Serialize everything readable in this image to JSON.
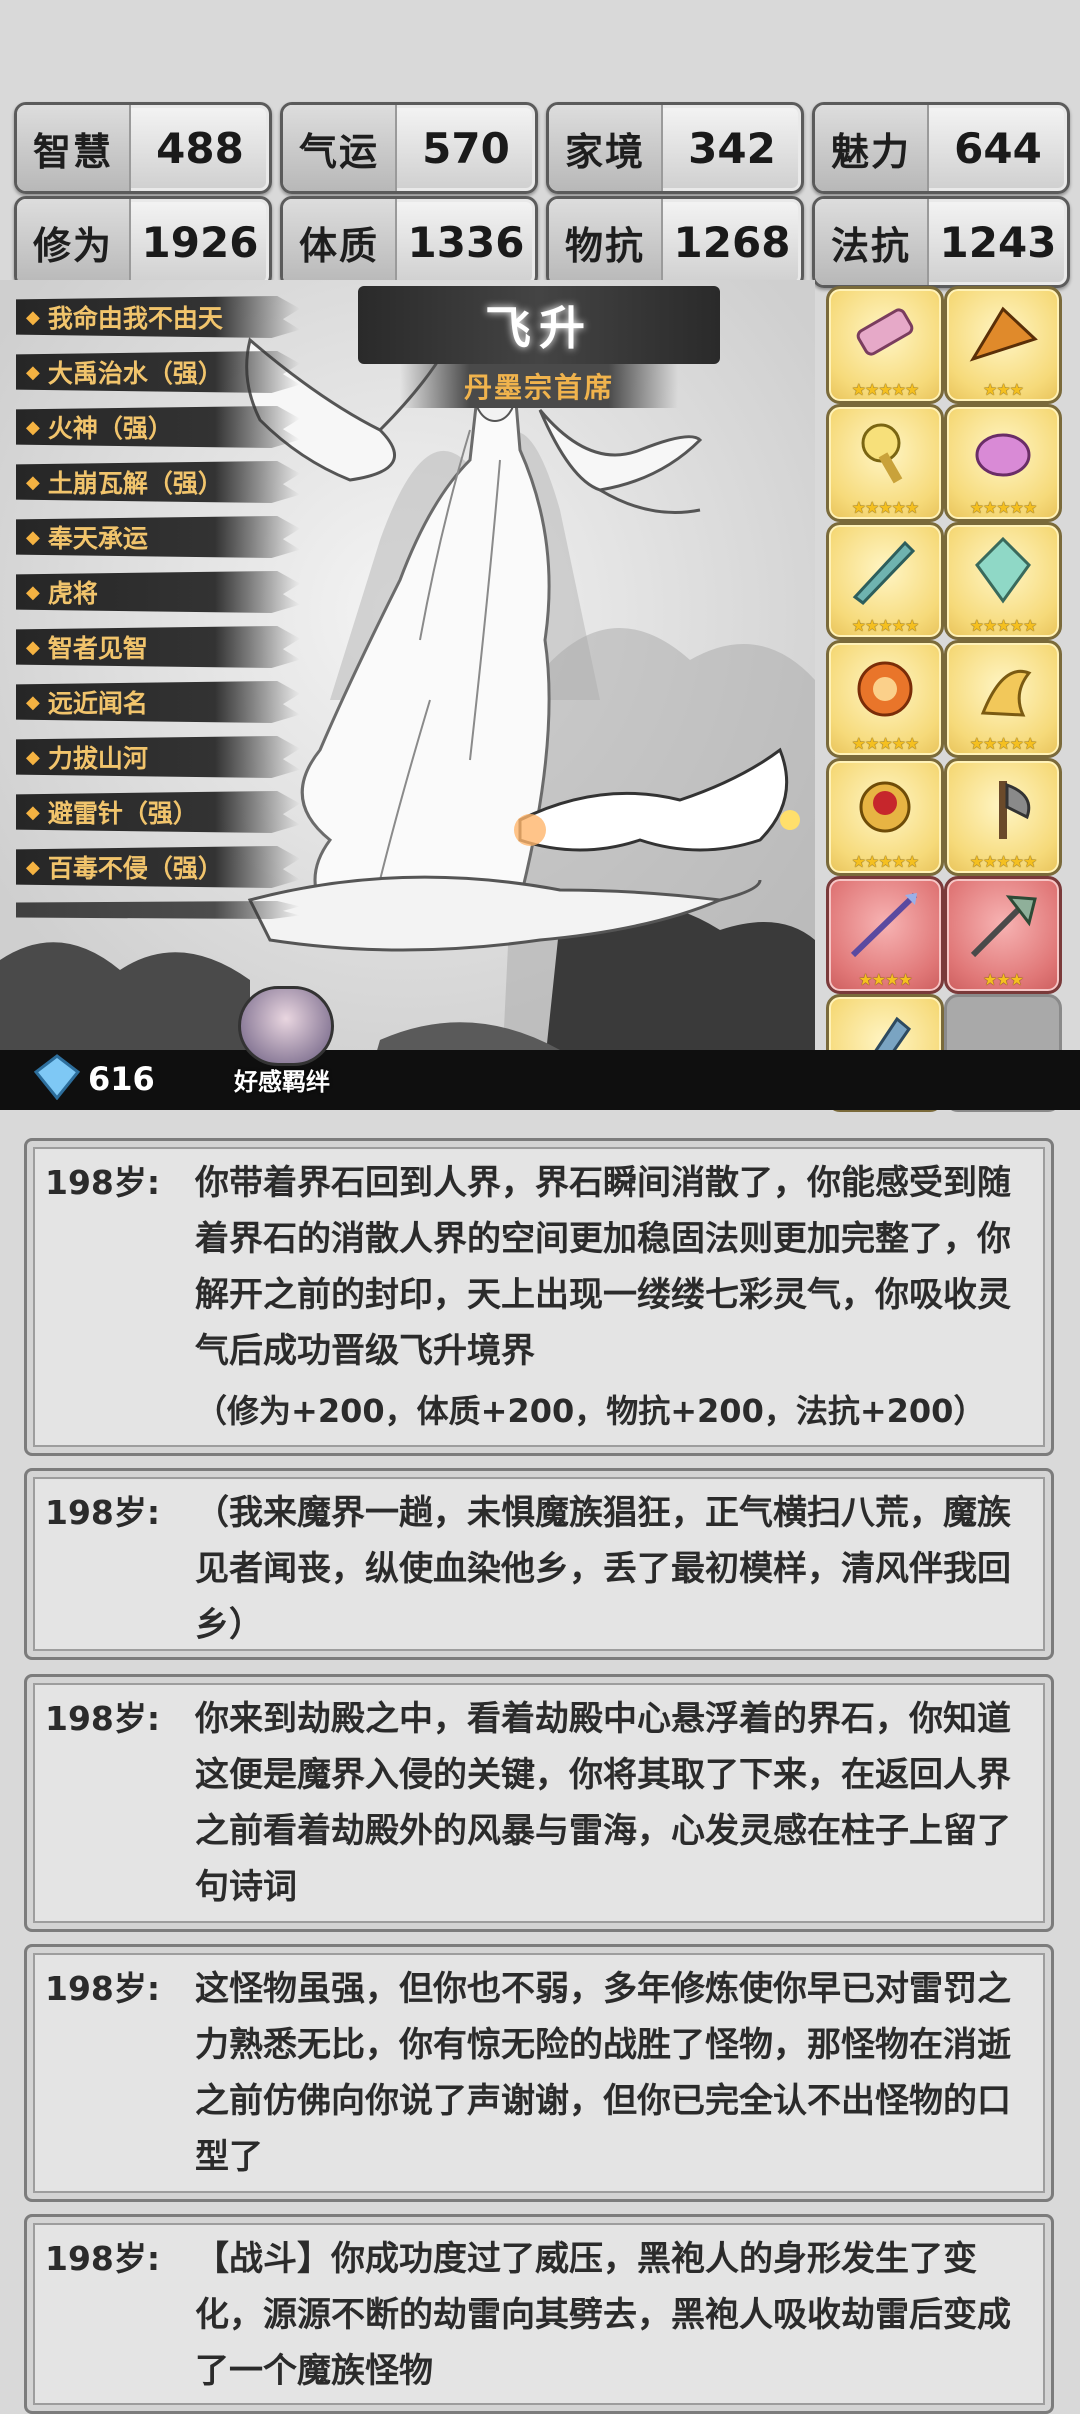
{
  "stats": [
    {
      "label": "智慧",
      "value": "488"
    },
    {
      "label": "气运",
      "value": "570"
    },
    {
      "label": "家境",
      "value": "342"
    },
    {
      "label": "魅力",
      "value": "644"
    },
    {
      "label": "修为",
      "value": "1926"
    },
    {
      "label": "体质",
      "value": "1336"
    },
    {
      "label": "物抗",
      "value": "1268"
    },
    {
      "label": "法抗",
      "value": "1243"
    }
  ],
  "realm": {
    "title": "飞升",
    "sect": "丹墨宗首席"
  },
  "skills": [
    "我命由我不由天",
    "大禹治水（强）",
    "火神（强）",
    "土崩瓦解（强）",
    "奉天承运",
    "虎将",
    "智者见智",
    "远近闻名",
    "力拔山河",
    "避雷针（强）",
    "百毒不侵（强）"
  ],
  "equipment": [
    {
      "icon": "scroll-icon",
      "stars": "★★★★★",
      "color": "gold"
    },
    {
      "icon": "fan-icon",
      "stars": "★★★",
      "color": "gold"
    },
    {
      "icon": "bell-staff-icon",
      "stars": "★★★★★",
      "color": "gold"
    },
    {
      "icon": "teapot-icon",
      "stars": "★★★★★",
      "color": "gold"
    },
    {
      "icon": "sword-icon",
      "stars": "★★★★★",
      "color": "gold"
    },
    {
      "icon": "crystal-icon",
      "stars": "★★★★★",
      "color": "gold"
    },
    {
      "icon": "fire-ring-icon",
      "stars": "★★★★★",
      "color": "gold"
    },
    {
      "icon": "phoenix-icon",
      "stars": "★★★★★",
      "color": "gold"
    },
    {
      "icon": "ruby-ring-icon",
      "stars": "★★★★★",
      "color": "gold"
    },
    {
      "icon": "axe-icon",
      "stars": "★★★★★",
      "color": "gold"
    },
    {
      "icon": "spear-icon",
      "stars": "★★★★",
      "color": "red"
    },
    {
      "icon": "halberd-icon",
      "stars": "★★★",
      "color": "red"
    },
    {
      "icon": "dagger-icon",
      "stars": "★",
      "color": "gold"
    },
    {
      "icon": "",
      "stars": "",
      "color": "empty"
    }
  ],
  "currency": {
    "value": "616"
  },
  "bond": {
    "label": "好感羁绊"
  },
  "logs": [
    {
      "age": "198岁:",
      "text": "你带着界石回到人界，界石瞬间消散了，你能感受到随着界石的消散人界的空间更加稳固法则更加完整了，你解开之前的封印，天上出现一缕缕七彩灵气，你吸收灵气后成功晋级飞升境界",
      "extra": "（修为+200，体质+200，物抗+200，法抗+200）"
    },
    {
      "age": "198岁:",
      "text": "（我来魔界一趟，未惧魔族猖狂，正气横扫八荒，魔族见者闻丧，纵使血染他乡，丢了最初模样，清风伴我回乡）",
      "extra": ""
    },
    {
      "age": "198岁:",
      "text": "你来到劫殿之中，看着劫殿中心悬浮着的界石，你知道这便是魔界入侵的关键，你将其取了下来，在返回人界之前看着劫殿外的风暴与雷海，心发灵感在柱子上留了句诗词",
      "extra": ""
    },
    {
      "age": "198岁:",
      "text": "这怪物虽强，但你也不弱，多年修炼使你早已对雷罚之力熟悉无比，你有惊无险的战胜了怪物，那怪物在消逝之前仿佛向你说了声谢谢，但你已完全认不出怪物的口型了",
      "extra": ""
    },
    {
      "age": "198岁:",
      "text": "【战斗】你成功度过了威压，黑袍人的身形发生了变化，源源不断的劫雷向其劈去，黑袍人吸收劫雷后变成了一个魔族怪物",
      "extra": ""
    }
  ]
}
